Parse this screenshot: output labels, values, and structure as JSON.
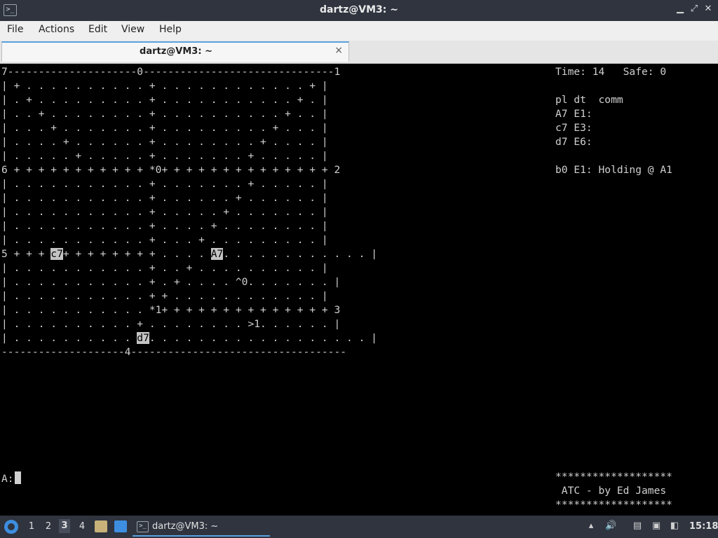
{
  "window": {
    "title": "dartz@VM3: ~"
  },
  "menu": [
    "File",
    "Actions",
    "Edit",
    "View",
    "Help"
  ],
  "tab": {
    "title": "dartz@VM3: ~",
    "close": "×"
  },
  "radar_rows": [
    [
      {
        "t": "7---------------------0-------------------------------1"
      }
    ],
    [
      {
        "t": "| + . . . . . . . . . . + . . . . . . . . . . . . + |"
      }
    ],
    [
      {
        "t": "| . + . . . . . . . . . + . . . . . . . . . . . + . |"
      }
    ],
    [
      {
        "t": "| . . + . . . . . . . . + . . . . . . . . . . + . . |"
      }
    ],
    [
      {
        "t": "| . . . + . . . . . . . + . . . . . . . . . + . . . |"
      }
    ],
    [
      {
        "t": "| . . . . + . . . . . . + . . . . . . . . + . . . . |"
      }
    ],
    [
      {
        "t": "| . . . . . + . . . . . + . . . . . . . + . . . . . |"
      }
    ],
    [
      {
        "t": "6 + + + + + + + + + + + *0+ + + + + + + + + + + + + + 2"
      }
    ],
    [
      {
        "t": "| . . . . . . . . . . . + . . . . . . . + . . . . . |"
      }
    ],
    [
      {
        "t": "| . . . . . . . . . . . + . . . . . . + . . . . . . |"
      }
    ],
    [
      {
        "t": "| . . . . . . . . . . . + . . . . . + . . . . . . . |"
      }
    ],
    [
      {
        "t": "| . . . . . . . . . . . + . . . . + . . . . . . . . |"
      }
    ],
    [
      {
        "t": "| . . . . . . . . . . . + . . . + . . . . . . . . . |"
      }
    ],
    [
      {
        "t": "5 + + + "
      },
      {
        "t": "c7",
        "hl": true
      },
      {
        "t": "+ + + + + + + + . . . . "
      },
      {
        "t": "A7",
        "hl": true
      },
      {
        "t": ". . . . . . . . . . . . |"
      }
    ],
    [
      {
        "t": "| . . . . . . . . . . . + . . + . . . . . . . . . . |"
      }
    ],
    [
      {
        "t": "| . . . . . . . . . . . + . + . . . . ^0. . . . . . . |"
      }
    ],
    [
      {
        "t": "| . . . . . . . . . . . + + . . . . . . . . . . . . |"
      }
    ],
    [
      {
        "t": "| . . . . . . . . . . . *1+ + + + + + + + + + + + + + 3"
      }
    ],
    [
      {
        "t": "| . . . . . . . . . . + . . . . . . . . >1. . . . . . |"
      }
    ],
    [
      {
        "t": "| . . . . . . . . . . "
      },
      {
        "t": "d7",
        "hl": true
      },
      {
        "t": ". . . . . . . . . . . . . . . . . . |"
      }
    ],
    [
      {
        "t": "--------------------4-----------------------------------"
      }
    ]
  ],
  "info_lines": [
    "Time: 14   Safe: 0",
    "",
    "pl dt  comm",
    "A7 E1:",
    "c7 E3:",
    "d7 E6:",
    "",
    "b0 E1: Holding @ A1"
  ],
  "credits_lines": [
    "*******************",
    " ATC - by Ed James",
    "*******************"
  ],
  "prompt": {
    "text": "A:"
  },
  "taskbar": {
    "workspaces": [
      "1",
      "2",
      "3",
      "4"
    ],
    "active_workspace": "3",
    "task_label": "dartz@VM3: ~",
    "clock": "15:18"
  }
}
